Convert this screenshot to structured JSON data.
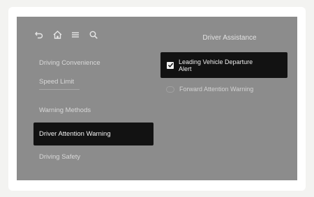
{
  "header": {
    "icons": [
      "back-icon",
      "home-icon",
      "menu-icon",
      "search-icon"
    ],
    "title": "Driver Assistance"
  },
  "menu": {
    "items": [
      {
        "label": "Driving Convenience"
      },
      {
        "label": "Speed Limit"
      },
      {
        "label": "Warning Methods"
      },
      {
        "label": "Driver Attention Warning",
        "selected": true
      },
      {
        "label": "Driving Safety"
      }
    ]
  },
  "options": [
    {
      "label": "Leading Vehicle Departure Alert",
      "checked": true
    },
    {
      "label": "Forward Attention Warning",
      "checked": false
    }
  ],
  "colors": {
    "screen_bg": "#8c8c8c",
    "highlight_bg": "#121212",
    "text": "#d8d8d8"
  }
}
